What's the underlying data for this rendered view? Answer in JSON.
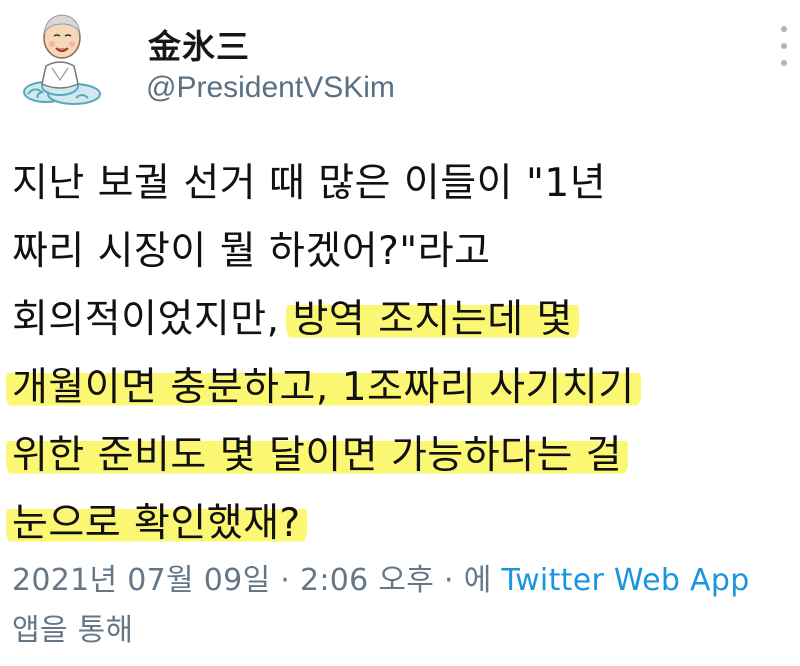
{
  "user": {
    "display_name": "金氷三",
    "handle": "@PresidentVSKim",
    "avatar_icon": "cartoon-old-man-on-cloud-icon"
  },
  "tweet": {
    "lines": [
      {
        "plain": "지난 보궐 선거 때 많은 이들이 \"1년",
        "highlight": ""
      },
      {
        "plain": "짜리 시장이 뭘 하겠어?\"라고",
        "highlight": ""
      },
      {
        "plain": "회의적이었지만, ",
        "highlight": "방역 조지는데 몇"
      },
      {
        "plain": "",
        "highlight": "개월이면 충분하고, 1조짜리 사기치기"
      },
      {
        "plain": "",
        "highlight": "위한 준비도 몇 달이면 가능하다는 걸"
      },
      {
        "plain": "",
        "highlight": "눈으로 확인했재?"
      }
    ],
    "highlight_color": "#faf65a"
  },
  "meta": {
    "timestamp": "2021년 07월 09일 · 2:06 오후 · 에 ",
    "source": "Twitter Web App",
    "suffix": "앱을 통해",
    "source_color": "#1b95e0"
  },
  "menu": {
    "more_icon": "more-vertical-icon"
  }
}
